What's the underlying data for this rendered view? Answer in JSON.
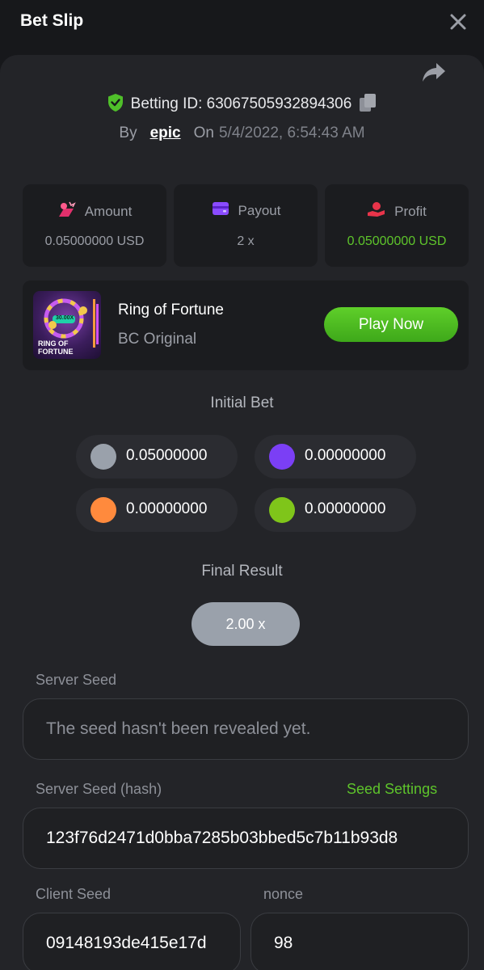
{
  "header": {
    "title": "Bet Slip"
  },
  "bet": {
    "id_label": "Betting ID: 63067505932894306",
    "by_label": "By",
    "user": "epic",
    "on_label": "On",
    "date": "5/4/2022, 6:54:43 AM"
  },
  "stats": {
    "amount": {
      "label": "Amount",
      "value": "0.05000000 USD"
    },
    "payout": {
      "label": "Payout",
      "value": "2 x"
    },
    "profit": {
      "label": "Profit",
      "value": "0.05000000 USD"
    }
  },
  "game": {
    "name": "Ring of Fortune",
    "provider": "BC Original",
    "play_label": "Play Now",
    "thumb_multiplier": "30.00X",
    "thumb_title_line1": "RING OF",
    "thumb_title_line2": "FORTUNE"
  },
  "initial_bet": {
    "title": "Initial Bet",
    "chips": [
      {
        "color": "#9aa1ab",
        "value": "0.05000000"
      },
      {
        "color": "#7b3ff5",
        "value": "0.00000000"
      },
      {
        "color": "#ff8a3d",
        "value": "0.00000000"
      },
      {
        "color": "#7fc51a",
        "value": "0.00000000"
      }
    ]
  },
  "final_result": {
    "title": "Final Result",
    "value": "2.00 x"
  },
  "seeds": {
    "server_seed_label": "Server Seed",
    "server_seed_value": "The seed hasn't been revealed yet.",
    "server_hash_label": "Server Seed (hash)",
    "seed_settings_label": "Seed Settings",
    "server_hash_value": "123f76d2471d0bba7285b03bbed5c7b11b93d8",
    "client_seed_label": "Client Seed",
    "client_seed_value": "09148193de415e17d",
    "nonce_label": "nonce",
    "nonce_value": "98"
  },
  "colors": {
    "accent_green": "#5ec42b",
    "panel": "#232428",
    "card": "#1b1c1f"
  }
}
